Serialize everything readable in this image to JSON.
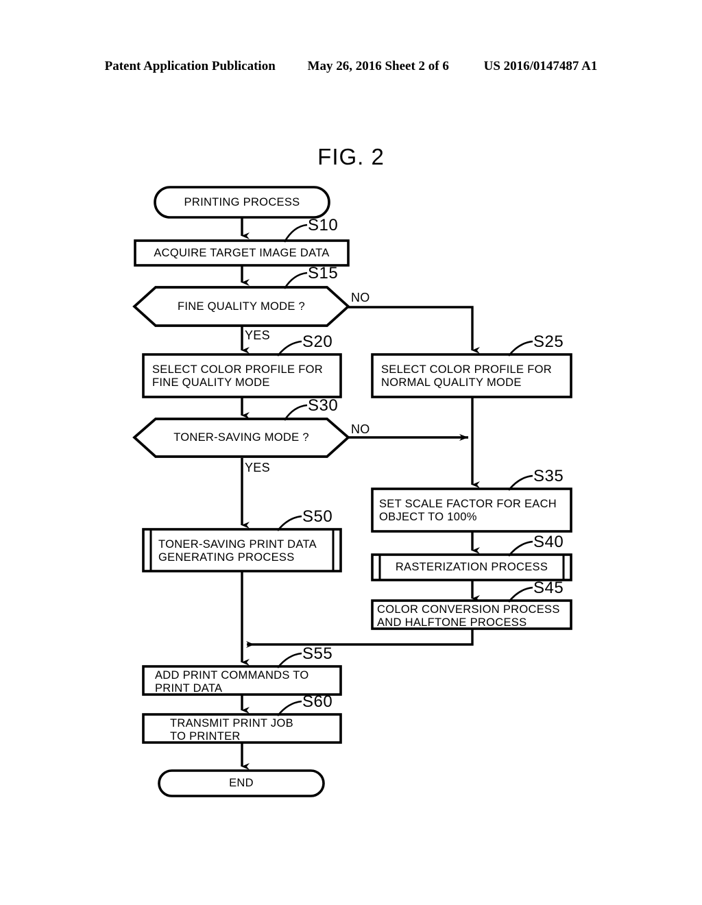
{
  "header": {
    "left": "Patent Application Publication",
    "middle": "May 26, 2016  Sheet 2 of 6",
    "right": "US 2016/0147487 A1"
  },
  "figure": {
    "title": "FIG. 2"
  },
  "flowchart": {
    "type": "flowchart",
    "nodes": [
      {
        "id": "start",
        "shape": "terminator",
        "text": "PRINTING PROCESS",
        "align": "center",
        "step": null
      },
      {
        "id": "s10",
        "shape": "process",
        "text": "ACQUIRE TARGET IMAGE DATA",
        "align": "center",
        "step": "S10"
      },
      {
        "id": "s15",
        "shape": "decision",
        "text": "FINE QUALITY MODE ?",
        "align": "center",
        "step": "S15"
      },
      {
        "id": "s20",
        "shape": "process",
        "text": "SELECT COLOR PROFILE FOR\nFINE QUALITY MODE",
        "align": "left",
        "step": "S20"
      },
      {
        "id": "s25",
        "shape": "process",
        "text": "SELECT COLOR PROFILE FOR\nNORMAL QUALITY MODE",
        "align": "left",
        "step": "S25"
      },
      {
        "id": "s30",
        "shape": "decision",
        "text": "TONER-SAVING MODE ?",
        "align": "center",
        "step": "S30"
      },
      {
        "id": "s35",
        "shape": "process",
        "text": "SET SCALE FACTOR FOR EACH\nOBJECT TO 100%",
        "align": "left",
        "step": "S35"
      },
      {
        "id": "s50",
        "shape": "predefined",
        "text": "TONER-SAVING PRINT DATA\nGENERATING PROCESS",
        "align": "left",
        "step": "S50"
      },
      {
        "id": "s40",
        "shape": "predefined",
        "text": "RASTERIZATION PROCESS",
        "align": "center",
        "step": "S40"
      },
      {
        "id": "s45",
        "shape": "process",
        "text": "COLOR CONVERSION PROCESS\nAND HALFTONE PROCESS",
        "align": "left",
        "step": "S45"
      },
      {
        "id": "s55",
        "shape": "process",
        "text": "ADD PRINT COMMANDS TO\nPRINT DATA",
        "align": "left",
        "step": "S55"
      },
      {
        "id": "s60",
        "shape": "process",
        "text": "TRANSMIT PRINT JOB\nTO PRINTER",
        "align": "left",
        "step": "S60"
      },
      {
        "id": "end",
        "shape": "terminator",
        "text": "END",
        "align": "center",
        "step": null
      }
    ],
    "branch_labels": [
      {
        "id": "s15-no",
        "text": "NO",
        "from": "s15"
      },
      {
        "id": "s15-yes",
        "text": "YES",
        "from": "s15"
      },
      {
        "id": "s30-no",
        "text": "NO",
        "from": "s30"
      },
      {
        "id": "s30-yes",
        "text": "YES",
        "from": "s30"
      }
    ],
    "edges": [
      {
        "from": "start",
        "to": "s10",
        "label": null
      },
      {
        "from": "s10",
        "to": "s15",
        "label": null
      },
      {
        "from": "s15",
        "to": "s20",
        "label": "YES"
      },
      {
        "from": "s15",
        "to": "s25",
        "label": "NO"
      },
      {
        "from": "s20",
        "to": "s30",
        "label": null
      },
      {
        "from": "s30",
        "to": "s50",
        "label": "YES"
      },
      {
        "from": "s30",
        "to": "s35",
        "label": "NO"
      },
      {
        "from": "s25",
        "to": "s35",
        "label": null
      },
      {
        "from": "s35",
        "to": "s40",
        "label": null
      },
      {
        "from": "s40",
        "to": "s45",
        "label": null
      },
      {
        "from": "s45",
        "to": "s55",
        "label": null
      },
      {
        "from": "s50",
        "to": "s55",
        "label": null
      },
      {
        "from": "s55",
        "to": "s60",
        "label": null
      },
      {
        "from": "s60",
        "to": "end",
        "label": null
      }
    ],
    "colors": {
      "stroke": "#000000",
      "fill": "#ffffff",
      "background": "#ffffff"
    }
  }
}
